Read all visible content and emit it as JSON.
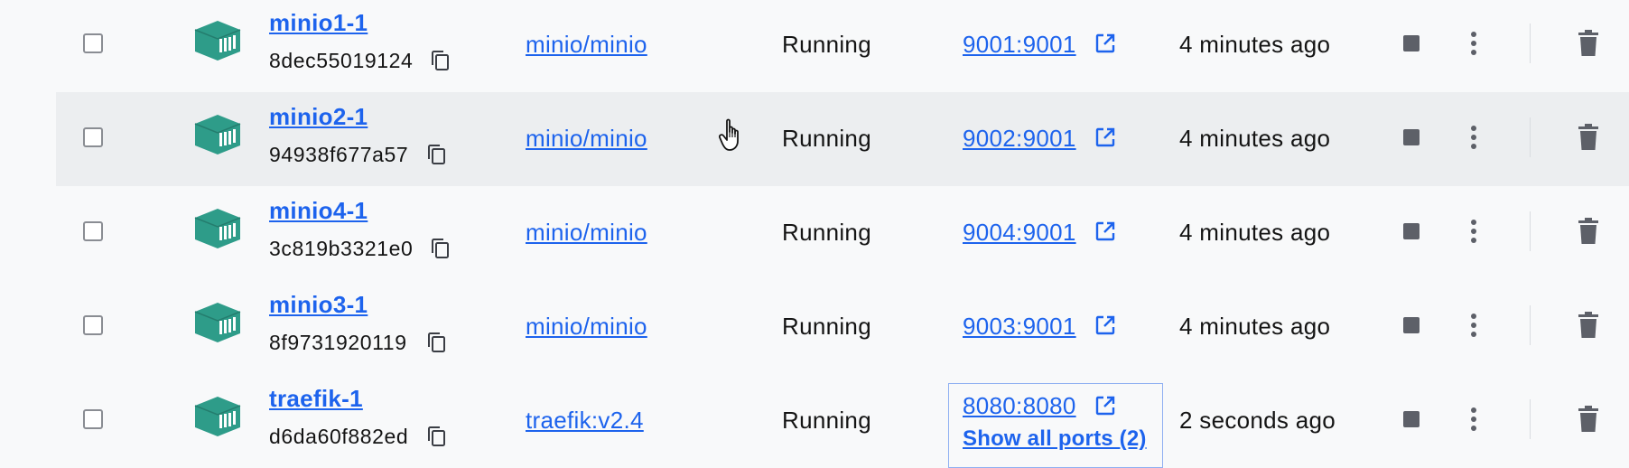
{
  "colors": {
    "accent": "#1d63ed",
    "container_icon": "#2e9c89",
    "row_hover": "#eceef0",
    "background": "#f8f9fa"
  },
  "containers": [
    {
      "name": "minio1-1",
      "id": "8dec55019124",
      "image": "minio/minio",
      "status": "Running",
      "port": "9001:9001",
      "created": "4 minutes ago"
    },
    {
      "name": "minio2-1",
      "id": "94938f677a57",
      "image": "minio/minio",
      "status": "Running",
      "port": "9002:9001",
      "created": "4 minutes ago"
    },
    {
      "name": "minio4-1",
      "id": "3c819b3321e0",
      "image": "minio/minio",
      "status": "Running",
      "port": "9004:9001",
      "created": "4 minutes ago"
    },
    {
      "name": "minio3-1",
      "id": "8f9731920119",
      "image": "minio/minio",
      "status": "Running",
      "port": "9003:9001",
      "created": "4 minutes ago"
    },
    {
      "name": "traefik-1",
      "id": "d6da60f882ed",
      "image": "traefik:v2.4",
      "status": "Running",
      "port": "8080:8080",
      "created": "2 seconds ago",
      "show_ports_label": "Show all ports (2)"
    }
  ],
  "icons": {
    "container": "container-icon",
    "copy": "copy-icon",
    "external_link": "external-link-icon",
    "stop": "stop-icon",
    "more": "kebab-menu-icon",
    "delete": "trash-icon",
    "cursor": "hand-cursor-icon"
  }
}
